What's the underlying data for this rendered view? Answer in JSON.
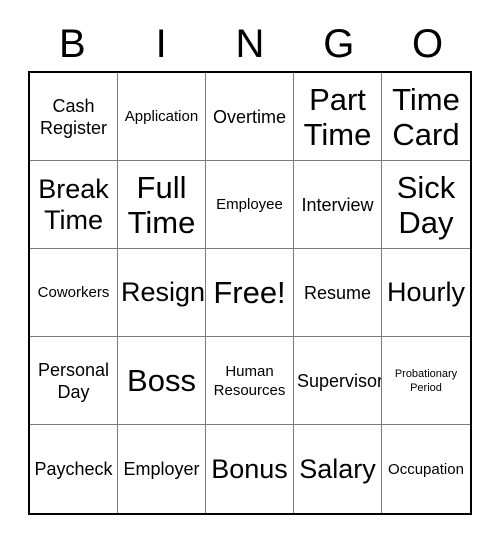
{
  "card": {
    "title": "BINGO",
    "header_letters": [
      "B",
      "I",
      "N",
      "G",
      "O"
    ],
    "grid_size": "5x5",
    "free_space_label": "Free!",
    "colors": {
      "background": "#ffffff",
      "text": "#000000",
      "outer_border": "#000000",
      "inner_grid_line": "#7a7a7a"
    },
    "rows": [
      [
        {
          "label": "Cash Register",
          "size": "lg"
        },
        {
          "label": "Application",
          "size": "md"
        },
        {
          "label": "Overtime",
          "size": "lg"
        },
        {
          "label": "Part Time",
          "size": "xxxl"
        },
        {
          "label": "Time Card",
          "size": "xxxl"
        }
      ],
      [
        {
          "label": "Break Time",
          "size": "xxl"
        },
        {
          "label": "Full Time",
          "size": "xxxl"
        },
        {
          "label": "Employee",
          "size": "md"
        },
        {
          "label": "Interview",
          "size": "lg"
        },
        {
          "label": "Sick Day",
          "size": "xxxl"
        }
      ],
      [
        {
          "label": "Coworkers",
          "size": "md"
        },
        {
          "label": "Resign",
          "size": "xxl"
        },
        {
          "label": "Free!",
          "size": "xxxl"
        },
        {
          "label": "Resume",
          "size": "lg"
        },
        {
          "label": "Hourly",
          "size": "xxl"
        }
      ],
      [
        {
          "label": "Personal Day",
          "size": "lg"
        },
        {
          "label": "Boss",
          "size": "xxxl"
        },
        {
          "label": "Human Resources",
          "size": "md"
        },
        {
          "label": "Supervisor",
          "size": "lg"
        },
        {
          "label": "Probationary Period",
          "size": "xs"
        }
      ],
      [
        {
          "label": "Paycheck",
          "size": "lg"
        },
        {
          "label": "Employer",
          "size": "lg"
        },
        {
          "label": "Bonus",
          "size": "xxl"
        },
        {
          "label": "Salary",
          "size": "xxl"
        },
        {
          "label": "Occupation",
          "size": "md"
        }
      ]
    ]
  }
}
